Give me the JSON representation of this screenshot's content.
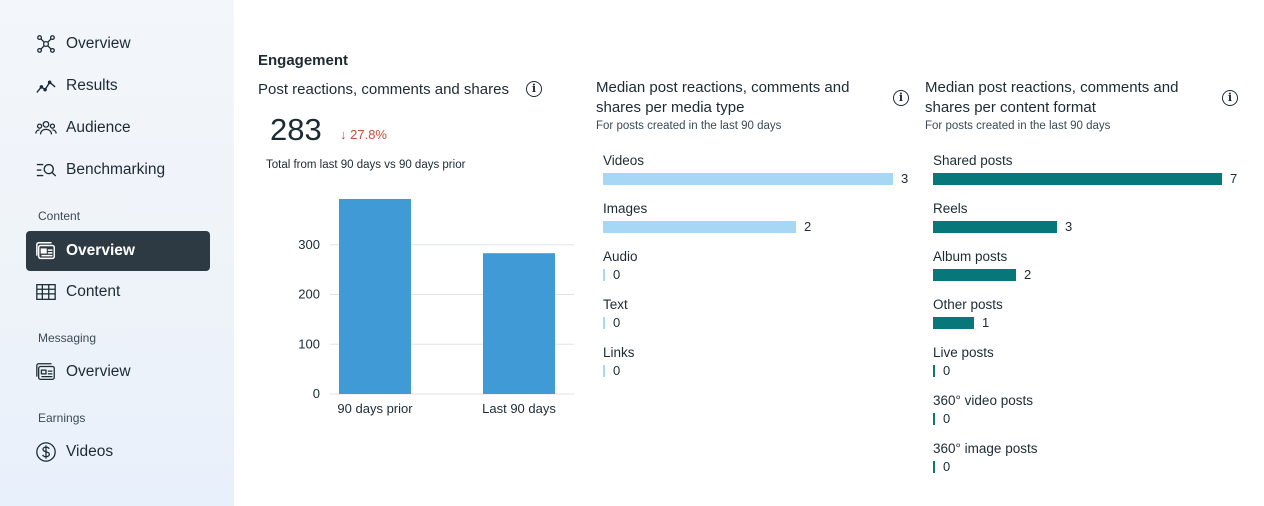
{
  "sidebar": {
    "items": [
      {
        "label": "Overview",
        "icon": "network-icon"
      },
      {
        "label": "Results",
        "icon": "trend-icon"
      },
      {
        "label": "Audience",
        "icon": "audience-icon"
      },
      {
        "label": "Benchmarking",
        "icon": "benchmark-search-icon"
      }
    ],
    "content_section": "Content",
    "content_items": [
      {
        "label": "Overview",
        "icon": "content-overview-icon",
        "active": true
      },
      {
        "label": "Content",
        "icon": "table-icon"
      }
    ],
    "messaging_section": "Messaging",
    "messaging_items": [
      {
        "label": "Overview",
        "icon": "messaging-overview-icon"
      }
    ],
    "earnings_section": "Earnings",
    "earnings_items": [
      {
        "label": "Videos",
        "icon": "dollar-icon"
      }
    ]
  },
  "main": {
    "section_title": "Engagement",
    "card1": {
      "title": "Post reactions, comments and shares",
      "total": "283",
      "delta": "27.8%",
      "delta_direction": "down",
      "note": "Total from last 90 days vs 90 days prior"
    },
    "card2": {
      "title_line1": "Median post reactions, comments and",
      "title_line2": "shares per media type",
      "subtitle": "For posts created in the last 90 days",
      "bar_color": "#a6d8f5",
      "rows": [
        {
          "name": "Videos",
          "value": "3"
        },
        {
          "name": "Images",
          "value": "2"
        },
        {
          "name": "Audio",
          "value": "0"
        },
        {
          "name": "Text",
          "value": "0"
        },
        {
          "name": "Links",
          "value": "0"
        }
      ]
    },
    "card3": {
      "title_line1": "Median post reactions, comments and",
      "title_line2": "shares per content format",
      "subtitle": "For posts created in the last 90 days",
      "bar_color": "#08777a",
      "rows": [
        {
          "name": "Shared posts",
          "value": "7"
        },
        {
          "name": "Reels",
          "value": "3"
        },
        {
          "name": "Album posts",
          "value": "2"
        },
        {
          "name": "Other posts",
          "value": "1"
        },
        {
          "name": "Live posts",
          "value": "0"
        },
        {
          "name": "360° video posts",
          "value": "0"
        },
        {
          "name": "360° image posts",
          "value": "0"
        }
      ]
    }
  },
  "chart_data": {
    "type": "bar",
    "categories": [
      "90 days prior",
      "Last 90 days"
    ],
    "values": [
      392,
      283
    ],
    "yticks": [
      "0",
      "100",
      "200",
      "300"
    ],
    "ylim": [
      0,
      400
    ],
    "grid": true,
    "bar_color": "#3f9ad6"
  }
}
